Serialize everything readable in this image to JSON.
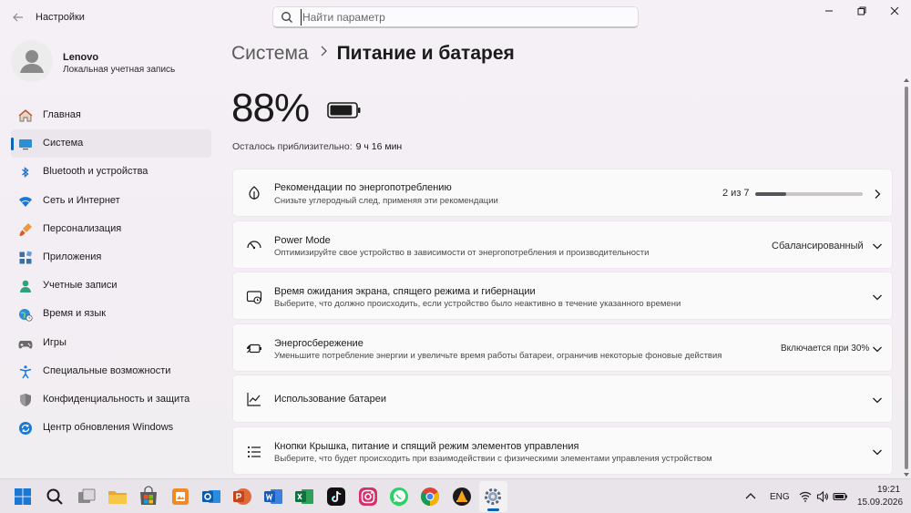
{
  "titlebar": {
    "back_icon": "back-arrow-icon",
    "app_title": "Настройки",
    "search_placeholder": "Найти параметр",
    "controls": [
      "minimize-icon",
      "maximize-icon",
      "close-icon"
    ]
  },
  "profile": {
    "name": "Lenovo",
    "account_type": "Локальная учетная запись"
  },
  "sidebar": {
    "items": [
      {
        "label": "Главная",
        "icon": "home-icon",
        "active": false
      },
      {
        "label": "Система",
        "icon": "display-icon",
        "active": true
      },
      {
        "label": "Bluetooth и устройства",
        "icon": "bluetooth-icon",
        "active": false
      },
      {
        "label": "Сеть и Интернет",
        "icon": "wifi-icon",
        "active": false
      },
      {
        "label": "Персонализация",
        "icon": "brush-icon",
        "active": false
      },
      {
        "label": "Приложения",
        "icon": "apps-icon",
        "active": false
      },
      {
        "label": "Учетные записи",
        "icon": "person-icon",
        "active": false
      },
      {
        "label": "Время и язык",
        "icon": "globe-clock-icon",
        "active": false
      },
      {
        "label": "Игры",
        "icon": "gamepad-icon",
        "active": false
      },
      {
        "label": "Специальные возможности",
        "icon": "accessibility-icon",
        "active": false
      },
      {
        "label": "Конфиденциальность и защита",
        "icon": "shield-icon",
        "active": false
      },
      {
        "label": "Центр обновления Windows",
        "icon": "update-icon",
        "active": false
      }
    ]
  },
  "main": {
    "breadcrumb_parent": "Система",
    "breadcrumb_current": "Питание и батарея",
    "battery_percent": "88%",
    "battery_level": 0.88,
    "remaining_label": "Осталось приблизительно:",
    "remaining_time": "9 ч 16 мин",
    "cards": [
      {
        "title": "Рекомендации по энергопотреблению",
        "desc": "Снизьте углеродный след, применяя эти рекомендации",
        "right": "2 из 7",
        "progress": 0.2857,
        "icon": "leaf-icon",
        "chevron": "chevron-right-icon"
      },
      {
        "title": "Power Mode",
        "desc": "Оптимизируйте свое устройство в зависимости от энергопотребления и производительности",
        "right": "Сбалансированный",
        "icon": "gauge-icon",
        "chevron": "chevron-down-icon"
      },
      {
        "title": "Время ожидания экрана, спящего режима и гибернации",
        "desc": "Выберите, что должно происходить, если устройство было неактивно в течение указанного времени",
        "right": "",
        "icon": "screen-sleep-icon",
        "chevron": "chevron-down-icon"
      },
      {
        "title": "Энергосбережение",
        "desc": "Уменьшите потребление энергии и увеличьте время работы батареи, ограничив некоторые фоновые действия",
        "right": "Включается при 30%",
        "icon": "battery-saver-icon",
        "chevron": "chevron-down-icon"
      },
      {
        "title": "Использование батареи",
        "desc": "",
        "right": "",
        "icon": "chart-icon",
        "chevron": "chevron-down-icon"
      },
      {
        "title": "Кнопки Крышка, питание и спящий режим элементов управления",
        "desc": "Выберите, что будет происходить при взаимодействии с физическими элементами управления устройством",
        "right": "",
        "icon": "list-icon",
        "chevron": "chevron-down-icon"
      }
    ]
  },
  "taskbar": {
    "apps": [
      "windows-start-icon",
      "search-icon",
      "task-view-icon",
      "file-explorer-icon",
      "store-icon",
      "photos-icon",
      "outlook-icon",
      "powerpoint-icon",
      "word-icon",
      "excel-icon",
      "tiktok-icon",
      "instagram-icon",
      "whatsapp-icon",
      "chrome-icon",
      "vlc-icon",
      "settings-icon"
    ],
    "tray": {
      "chevron_icon": "chevron-up-icon",
      "language": "ENG",
      "wifi_icon": "wifi-icon",
      "volume_icon": "volume-icon",
      "battery_icon": "battery-icon",
      "time": "19:21",
      "date": "15.09.2026"
    }
  },
  "colors": {
    "accent": "#0a64b8",
    "window_bg": "#f3eef3",
    "card_bg": "#fbfafb",
    "taskbar_bg": "#e8e4ea"
  }
}
